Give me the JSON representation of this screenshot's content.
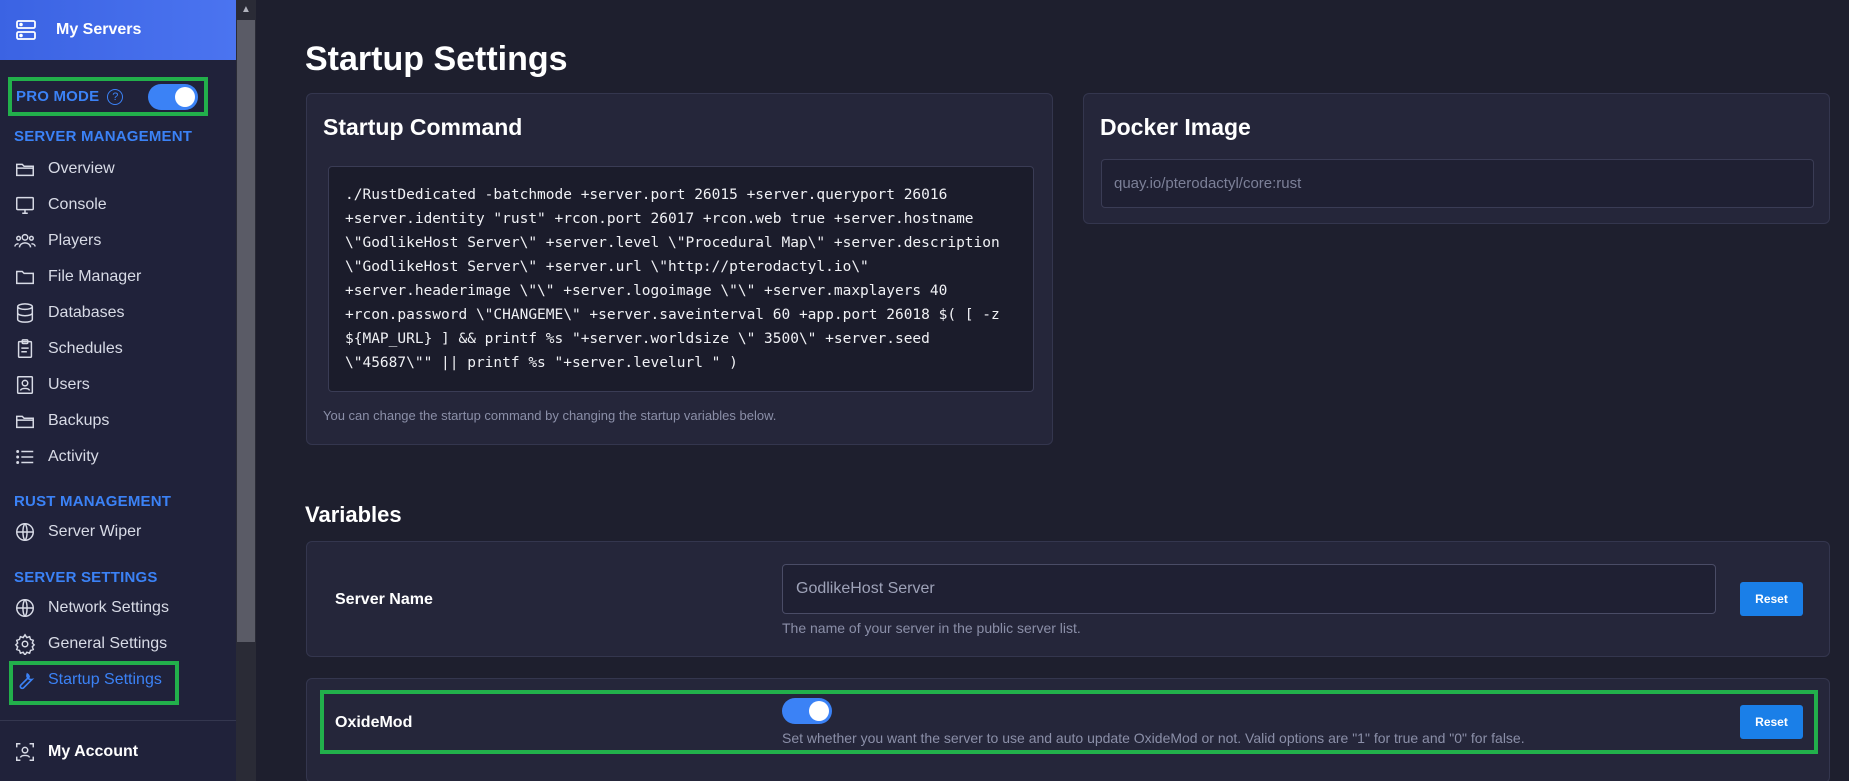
{
  "sidebar": {
    "header_label": "My Servers",
    "pro_mode": {
      "label": "PRO MODE",
      "help": "?",
      "enabled": true
    },
    "sections": {
      "server_management": "SERVER MANAGEMENT",
      "rust_management": "RUST MANAGEMENT",
      "server_settings": "SERVER SETTINGS"
    },
    "items": {
      "overview": "Overview",
      "console": "Console",
      "players": "Players",
      "file_manager": "File Manager",
      "databases": "Databases",
      "schedules": "Schedules",
      "users": "Users",
      "backups": "Backups",
      "activity": "Activity",
      "server_wiper": "Server Wiper",
      "network_settings": "Network Settings",
      "general_settings": "General Settings",
      "startup_settings": "Startup Settings"
    },
    "account_label": "My Account"
  },
  "main": {
    "page_title": "Startup Settings",
    "startup_command": {
      "title": "Startup Command",
      "command": "./RustDedicated -batchmode +server.port 26015 +server.queryport 26016 +server.identity \"rust\" +rcon.port 26017 +rcon.web true +server.hostname \\\"GodlikeHost Server\\\" +server.level \\\"Procedural Map\\\" +server.description \\\"GodlikeHost Server\\\" +server.url \\\"http://pterodactyl.io\\\" +server.headerimage \\\"\\\" +server.logoimage \\\"\\\" +server.maxplayers 40 +rcon.password \\\"CHANGEME\\\" +server.saveinterval 60 +app.port 26018 $( [ -z ${MAP_URL} ] && printf %s \"+server.worldsize \\\" 3500\\\" +server.seed \\\"45687\\\"\" || printf %s \"+server.levelurl \" )",
      "help": "You can change the startup command by changing the startup variables below."
    },
    "docker_image": {
      "title": "Docker Image",
      "value": "quay.io/pterodactyl/core:rust"
    },
    "variables_title": "Variables",
    "variables": [
      {
        "name": "Server Name",
        "value": "GodlikeHost Server",
        "description": "The name of your server in the public server list.",
        "reset_label": "Reset"
      },
      {
        "name": "OxideMod",
        "enabled": true,
        "description": "Set whether you want the server to use and auto update OxideMod or not. Valid options are \"1\" for true and \"0\" for false.",
        "reset_label": "Reset"
      }
    ]
  },
  "colors": {
    "accent": "#3b82f6",
    "highlight": "#22b04b",
    "button": "#1a7fe8"
  }
}
